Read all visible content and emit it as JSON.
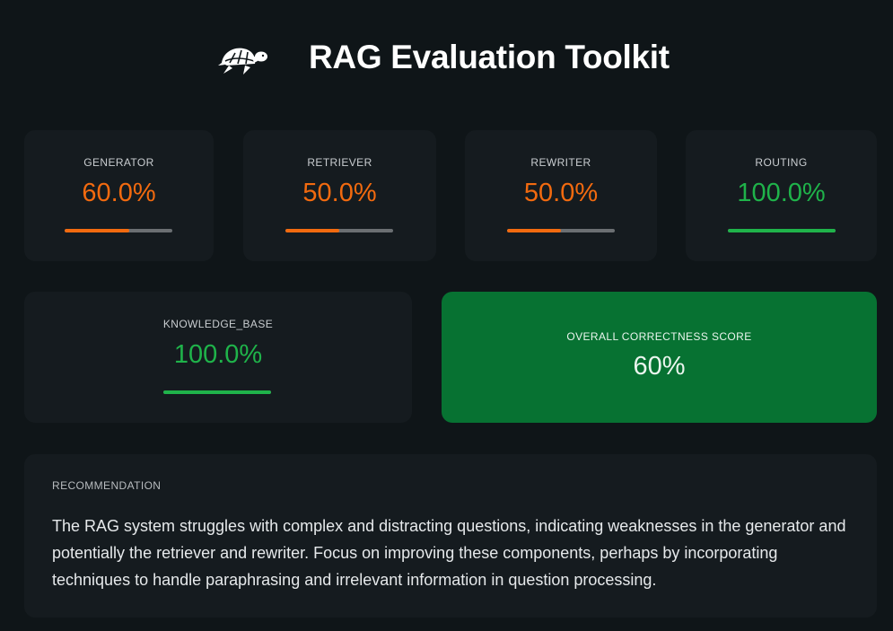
{
  "header": {
    "title": "RAG Evaluation Toolkit",
    "logo_icon": "turtle-logo-icon"
  },
  "metrics": [
    {
      "label": "GENERATOR",
      "value": "60.0%",
      "fraction": 0.6,
      "color": "#f26a0f"
    },
    {
      "label": "RETRIEVER",
      "value": "50.0%",
      "fraction": 0.5,
      "color": "#f26a0f"
    },
    {
      "label": "REWRITER",
      "value": "50.0%",
      "fraction": 0.5,
      "color": "#f26a0f"
    },
    {
      "label": "ROUTING",
      "value": "100.0%",
      "fraction": 1.0,
      "color": "#1fb34a"
    },
    {
      "label": "KNOWLEDGE_BASE",
      "value": "100.0%",
      "fraction": 1.0,
      "color": "#1fb34a"
    }
  ],
  "overall": {
    "label": "OVERALL CORRECTNESS SCORE",
    "value": "60%",
    "background": "#077232"
  },
  "recommendation": {
    "label": "RECOMMENDATION",
    "text": "The RAG system struggles with complex and distracting questions, indicating weaknesses in the generator and potentially the retriever and rewriter. Focus on improving these components, perhaps by incorporating techniques to handle paraphrasing and irrelevant information in question processing."
  }
}
